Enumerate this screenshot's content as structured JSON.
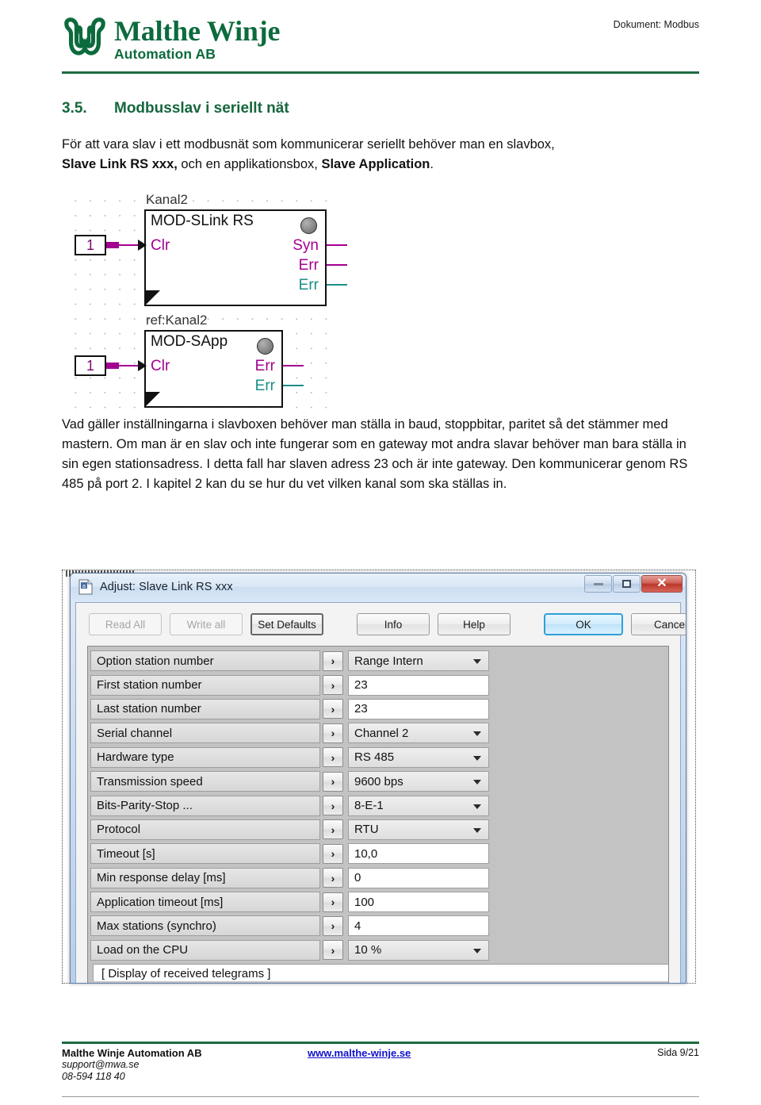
{
  "header": {
    "logo_title": "Malthe Winje",
    "logo_subtitle": "Automation AB",
    "document_label": "Dokument: Modbus",
    "brand_color": "#0c6b3d"
  },
  "section": {
    "number": "3.5.",
    "heading": "Modbusslav i seriellt nät",
    "heading_color": "#16673c"
  },
  "intro": {
    "line1": "För att vara slav i ett modbusnät som kommunicerar seriellt behöver man en slavbox,",
    "bold1": "Slave Link RS xxx,",
    "mid1": " och en applikationsbox, ",
    "bold2": "Slave Application",
    "end1": "."
  },
  "diagram": {
    "block1": {
      "title": "Kanal2",
      "name": "MOD-SLink RS",
      "input_const": "1",
      "input_port": "Clr",
      "outputs": [
        {
          "label": "Syn",
          "color": "#a3008f"
        },
        {
          "label": "Err",
          "color": "#a3008f"
        },
        {
          "label": "Err",
          "color": "#1a8f86"
        }
      ]
    },
    "block2": {
      "title": "ref:Kanal2",
      "name": "MOD-SApp",
      "input_const": "1",
      "input_port": "Clr",
      "outputs": [
        {
          "label": "Err",
          "color": "#a3008f"
        },
        {
          "label": "Err",
          "color": "#1a8f86"
        }
      ]
    }
  },
  "body": {
    "paragraph": "Vad gäller inställningarna i slavboxen behöver man ställa in baud, stoppbitar, paritet så det stämmer med mastern. Om man är en slav och inte fungerar som en gateway mot andra slavar behöver man bara ställa in sin egen stationsadress. I detta fall har slaven adress 23 och är inte gateway. Den kommunicerar genom RS 485 på port 2. I kapitel 2 kan du se hur du vet vilken kanal som ska ställas in."
  },
  "dialog": {
    "title": "Adjust: Slave Link RS xxx",
    "window_controls": {
      "minimize": "–",
      "maximize": "□",
      "close": "✕"
    },
    "toolbar": [
      {
        "label": "Read All",
        "state": "disabled"
      },
      {
        "label": "Write all",
        "state": "disabled"
      },
      {
        "label": "Set Defaults",
        "state": "default"
      },
      {
        "label": "Info",
        "state": "normal"
      },
      {
        "label": "Help",
        "state": "normal"
      },
      {
        "label": "OK",
        "state": "primary"
      },
      {
        "label": "Cancel",
        "state": "normal"
      }
    ],
    "settings": [
      {
        "label": "Option station number",
        "value": "Range Intern",
        "type": "combo",
        "expander": "›"
      },
      {
        "label": "First station number",
        "value": "23",
        "type": "text",
        "expander": "›"
      },
      {
        "label": "Last station number",
        "value": "23",
        "type": "text",
        "expander": "›"
      },
      {
        "label": "Serial channel",
        "value": "Channel 2",
        "type": "combo",
        "expander": "›"
      },
      {
        "label": "Hardware type",
        "value": "RS 485",
        "type": "combo",
        "expander": "›"
      },
      {
        "label": "Transmission speed",
        "value": "9600 bps",
        "type": "combo",
        "expander": "›"
      },
      {
        "label": "Bits-Parity-Stop ...",
        "value": "8-E-1",
        "type": "combo",
        "expander": "›"
      },
      {
        "label": "Protocol",
        "value": "RTU",
        "type": "combo",
        "expander": "›"
      },
      {
        "label": "Timeout [s]",
        "value": "10,0",
        "type": "text",
        "expander": "›"
      },
      {
        "label": "Min response delay [ms]",
        "value": "0",
        "type": "text",
        "expander": "›"
      },
      {
        "label": "Application timeout [ms]",
        "value": "100",
        "type": "text",
        "expander": "›"
      },
      {
        "label": "Max stations (synchro)",
        "value": "4",
        "type": "text",
        "expander": "›"
      },
      {
        "label": "Load on the CPU",
        "value": "10 %",
        "type": "combo",
        "expander": "›"
      }
    ],
    "clipped_row": "[ Display of received telegrams ]"
  },
  "footer": {
    "company": "Malthe Winje Automation AB",
    "email": "support@mwa.se",
    "phone": "08-594 118 40",
    "website": "www.malthe-winje.se",
    "page": "Sida 9/21"
  }
}
